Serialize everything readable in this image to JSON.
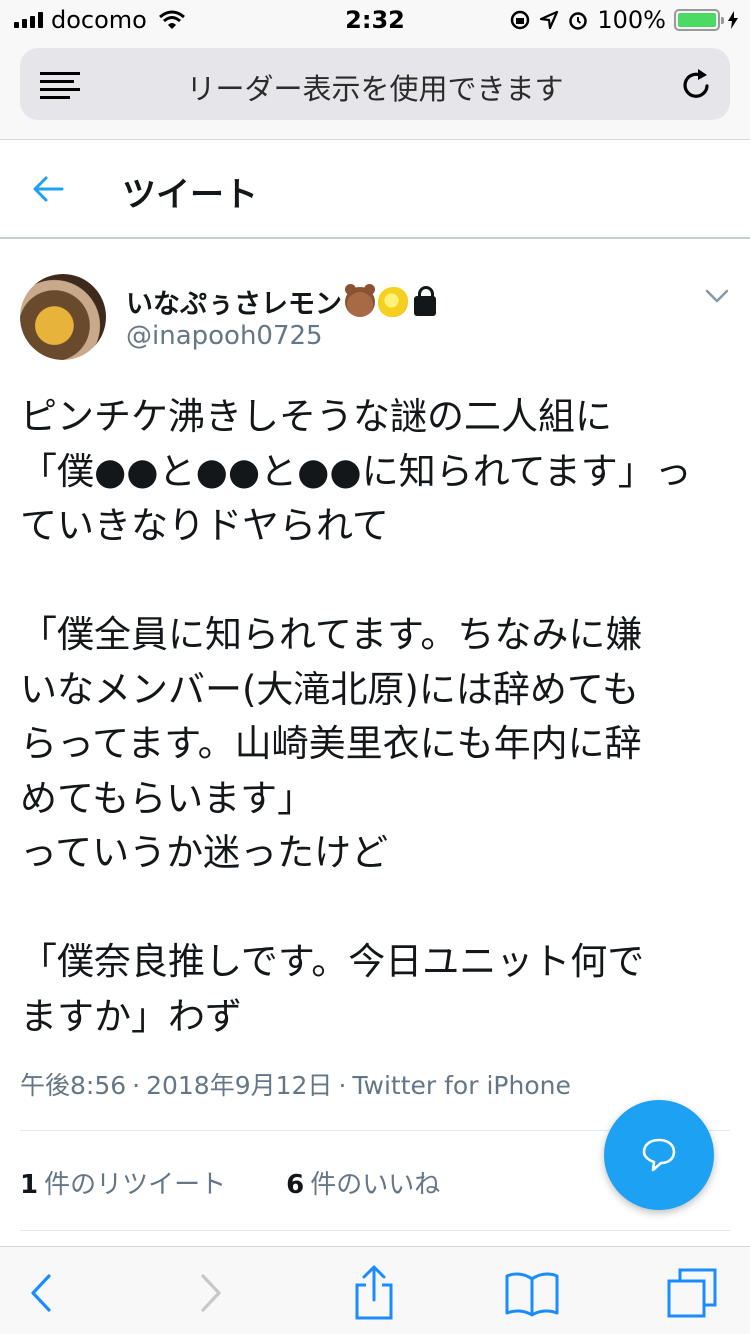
{
  "status_bar": {
    "carrier": "docomo",
    "time": "2:32",
    "battery_percent": "100%",
    "battery_level": 1.0
  },
  "url_bar": {
    "message": "リーダー表示を使用できます"
  },
  "header": {
    "title": "ツイート"
  },
  "tweet": {
    "display_name": "いなぷぅさレモン",
    "name_emojis": [
      "bear-emoji",
      "lemon-emoji",
      "lock-icon"
    ],
    "handle": "@inapooh0725",
    "lines": [
      "ピンチケ沸きしそうな謎の二人組に",
      "「僕●●と●●と●●に知られてます」っ",
      "ていきなりドヤられて",
      "",
      "「僕全員に知られてます。ちなみに嫌",
      "いなメンバー(大滝北原)には辞めても",
      "らってます。山崎美里衣にも年内に辞",
      "めてもらいます」",
      "っていうか迷ったけど",
      "",
      "「僕奈良推しです。今日ユニット何で",
      "ますか」わず"
    ],
    "time": "午後8:56",
    "date": "2018年9月12日",
    "separator": "·",
    "source": "Twitter for iPhone",
    "retweet_count": "1",
    "retweet_label": "件のリツイート",
    "like_count": "6",
    "like_label": "件のいいね"
  },
  "colors": {
    "accent": "#1da1f2",
    "secondary_text": "#657786",
    "battery": "#4cd964"
  }
}
